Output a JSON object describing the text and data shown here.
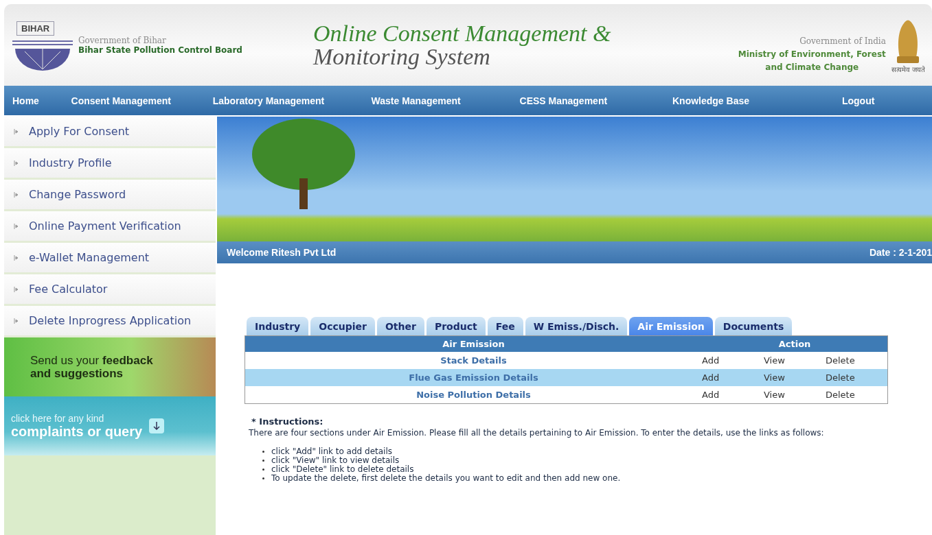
{
  "header": {
    "logo_text": "BIHAR",
    "gov_state": "Government of Bihar",
    "board": "Bihar State Pollution Control Board",
    "title_line1": "Online Consent Management &",
    "title_line2": "Monitoring System",
    "gov_india": "Government of India",
    "ministry_line1": "Ministry of Environment, Forest",
    "ministry_line2": "and Climate Change",
    "motto": "सत्यमेव जयते"
  },
  "nav": [
    "Home",
    "Consent Management",
    "Laboratory Management",
    "Waste Management",
    "CESS Management",
    "Knowledge Base",
    "Logout"
  ],
  "sidebar": {
    "items": [
      "Apply For Consent",
      "Industry Profile",
      "Change Password",
      "Online Payment Verification",
      "e-Wallet Management",
      "Fee Calculator",
      "Delete Inprogress Application"
    ],
    "feedback": "Send us your **feedback and suggestions**",
    "complaint_line1": "click here for any kind",
    "complaint_line2": "complaints or query"
  },
  "welcome": "Welcome Ritesh Pvt Ltd",
  "date": "Date : 2-1-201",
  "tabs": [
    {
      "label": "Industry",
      "selected": false
    },
    {
      "label": "Occupier",
      "selected": false
    },
    {
      "label": "Other",
      "selected": false
    },
    {
      "label": "Product",
      "selected": false
    },
    {
      "label": "Fee",
      "selected": false
    },
    {
      "label": "W Emiss./Disch.",
      "selected": false
    },
    {
      "label": "Air Emission",
      "selected": true
    },
    {
      "label": "Documents",
      "selected": false
    }
  ],
  "table": {
    "columns": [
      "Air Emission",
      "Action"
    ],
    "rows": [
      {
        "name": "Stack Details",
        "actions": [
          "Add",
          "View",
          "Delete"
        ],
        "highlighted": false
      },
      {
        "name": "Flue Gas Emission Details",
        "actions": [
          "Add",
          "View",
          "Delete"
        ],
        "highlighted": true
      },
      {
        "name": "Noise Pollution Details",
        "actions": [
          "Add",
          "View",
          "Delete"
        ],
        "highlighted": false
      }
    ]
  },
  "instructions": {
    "title": "* Instructions:",
    "text": "There are four sections under Air Emission. Please fill all the details pertaining to Air Emission. To enter the details, use the links as follows:",
    "items": [
      "click \"Add\" link to add details",
      "click \"View\" link to view details",
      "click \"Delete\" link to delete details",
      "To update the delete, first delete the details you want to edit and then add new one."
    ]
  }
}
